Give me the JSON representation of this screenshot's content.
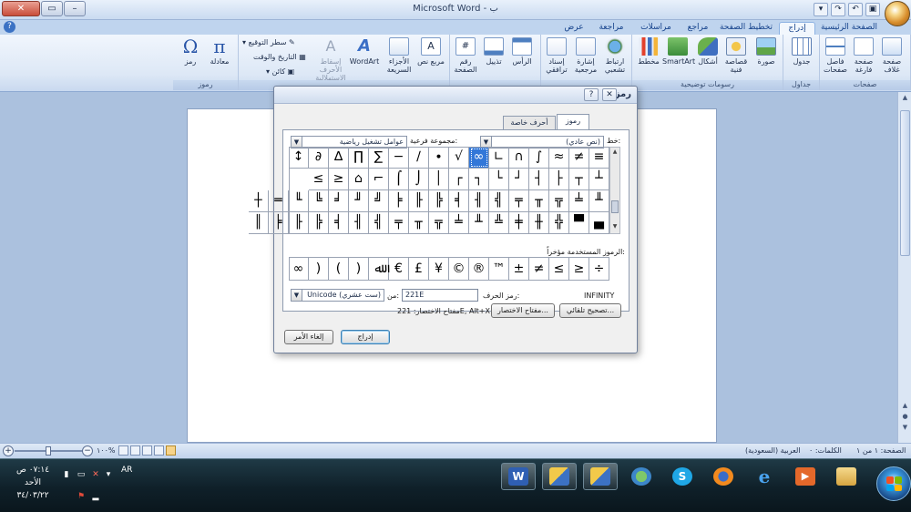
{
  "window": {
    "title": "Microsoft Word - ب",
    "controls": [
      "✕",
      "▭",
      "–"
    ]
  },
  "ribbon": {
    "tabs": [
      "الصفحة الرئيسية",
      "إدراج",
      "تخطيط الصفحة",
      "مراجع",
      "مراسلات",
      "مراجعة",
      "عرض"
    ],
    "active_tab": "إدراج",
    "groups": {
      "pages": {
        "label": "صفحات",
        "buttons": [
          "صفحة غلاف",
          "صفحة فارغة",
          "فاصل صفحات"
        ]
      },
      "tables": {
        "label": "جداول",
        "buttons": [
          "جدول"
        ]
      },
      "illustrations": {
        "label": "رسومات توضيحية",
        "buttons": [
          "صورة",
          "قصاصة فنية",
          "أشكال",
          "SmartArt",
          "مخطط"
        ]
      },
      "links": {
        "label": "ارتباطات",
        "buttons": [
          "ارتباط تشعبي",
          "إشارة مرجعية",
          "إسناد ترافقي"
        ]
      },
      "header_footer": {
        "label": "رأس وتذييل",
        "buttons": [
          "الرأس",
          "تذييل",
          "رقم الصفحة"
        ]
      },
      "text": {
        "label": "نص",
        "buttons": [
          "مربع نص",
          "الأجزاء السريعة",
          "WordArt",
          "إسقاط الأحرف الاستهلالية"
        ],
        "small": [
          "سطر التوقيع",
          "التاريخ والوقت",
          "كائن"
        ]
      },
      "symbols": {
        "label": "رموز",
        "buttons": [
          "معادلة",
          "رمز"
        ]
      }
    }
  },
  "statusbar": {
    "page": "الصفحة: ١ من ١",
    "words": "الكلمات: ٠",
    "language": "العربية (السعودية)",
    "zoom": "١٠٠%"
  },
  "taskbar": {
    "time": "٠٧:١٤ ص",
    "day": "الأحد",
    "date": "٣٤/٠٣/٢٢",
    "lang": "AR"
  },
  "dialog": {
    "title": "رمز",
    "help": "?",
    "close": "✕",
    "tabs": [
      "رموز",
      "أحرف خاصة"
    ],
    "font_label": "خط:",
    "font_value": "(نص عادي)",
    "subset_label": "مجموعة فرعية:",
    "subset_value": "عوامل تشغيل رياضية",
    "symbol_rows": [
      [
        "≡",
        "≠",
        "≈",
        "∫",
        "∩",
        "∟",
        "∞",
        "√",
        "∙",
        "∕",
        "−",
        "∑",
        "∏",
        "∆",
        "∂",
        "↕"
      ],
      [
        "┴",
        "┬",
        "├",
        "┤",
        "┘",
        "└",
        "┐",
        "┌",
        "│",
        "⌡",
        "⌠",
        "⌐",
        "⌂",
        "≥",
        "≤"
      ],
      [
        "╨",
        "╧",
        "╦",
        "╥",
        "╤",
        "╣",
        "╢",
        "╡",
        "╠",
        "╟",
        "╞",
        "╝",
        "╜",
        "╛",
        "╚",
        "╙",
        "═",
        "┼"
      ],
      [
        "▄",
        "▀",
        "╬",
        "╫",
        "╪",
        "╩",
        "╨",
        "╧",
        "╦",
        "╥",
        "╤",
        "╣",
        "╢",
        "╡",
        "╠",
        "╟",
        "╞",
        "║"
      ]
    ],
    "selected_symbol": "∞",
    "recent_label": "الرموز المستخدمة مؤخراً:",
    "recent_symbols": [
      "÷",
      "≥",
      "≤",
      "≠",
      "±",
      "™",
      "®",
      "©",
      "¥",
      "£",
      "€",
      "ﷲ",
      ")",
      "(",
      ")",
      "∞"
    ],
    "char_name": "INFINITY",
    "char_code_label": "رمز الحرف:",
    "char_code": "221E",
    "from_label": "من:",
    "from_value": "Unicode (ست عشري)",
    "autocorrect_btn": "تصحيح تلقائي...",
    "shortcut_btn": "مفتاح الاختصار...",
    "shortcut_text": "مفتاح الاختصار: 221E, Alt+X",
    "insert_btn": "إدراج",
    "cancel_btn": "إلغاء الأمر"
  },
  "colors": {
    "accent": "#3277d8",
    "ribbon_bg": "#dde8f6",
    "workspace": "#abc1de",
    "taskbar": "#0f2029"
  }
}
